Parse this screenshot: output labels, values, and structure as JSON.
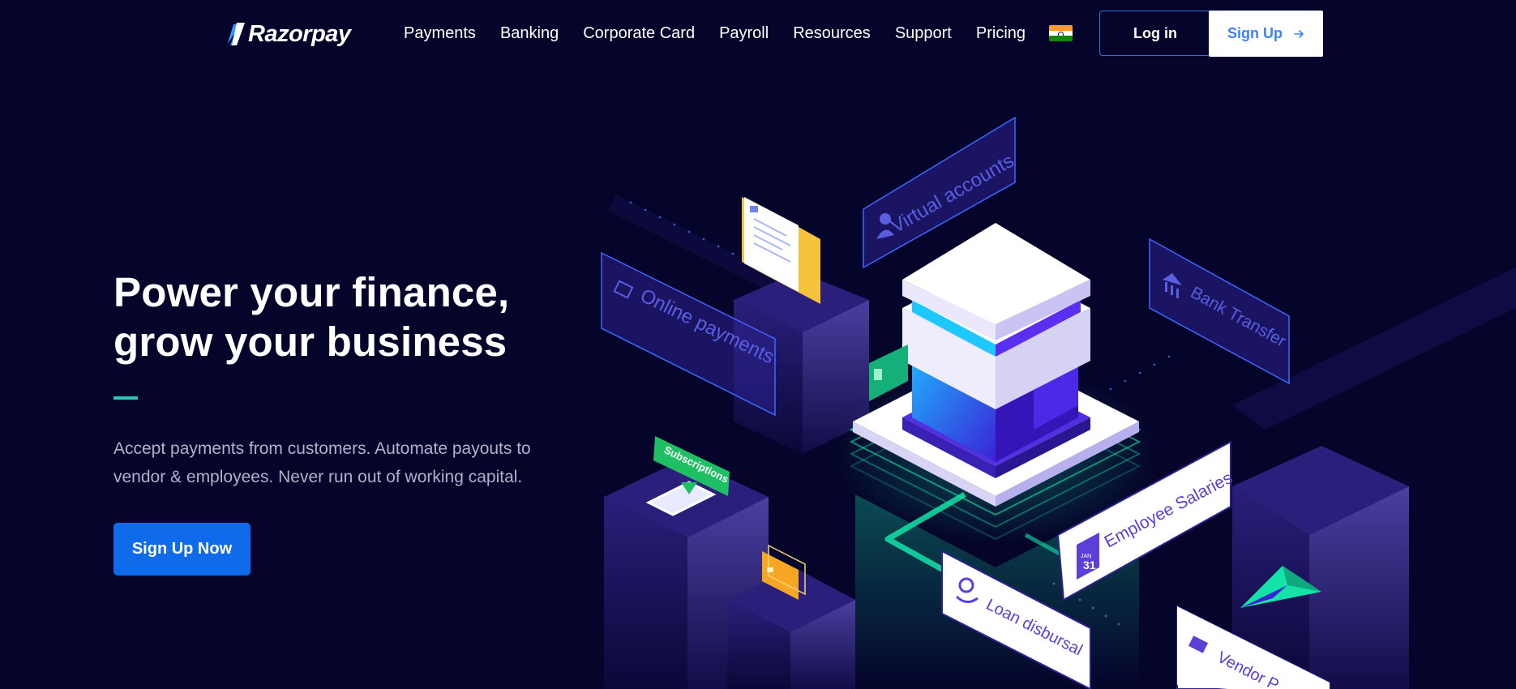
{
  "brand": {
    "name": "Razorpay"
  },
  "nav": {
    "links": [
      "Payments",
      "Banking",
      "Corporate Card",
      "Payroll",
      "Resources",
      "Support",
      "Pricing"
    ],
    "login_label": "Log in",
    "signup_label": "Sign Up",
    "signup_icon": "arrow-right-icon",
    "flag_icon": "india-flag-icon"
  },
  "hero": {
    "title_line1": "Power your finance,",
    "title_line2": "grow your business",
    "subtitle_line1": "Accept payments from customers. Automate payouts to",
    "subtitle_line2": "vendor & employees. Never run out of working capital.",
    "cta_label": "Sign Up Now"
  },
  "illustration": {
    "labels": {
      "virtual_accounts": "Virtual accounts",
      "online_payments": "Online payments",
      "bank_transfer": "Bank Transfer",
      "subscriptions": "Subscriptions",
      "employee_salaries": "Employee Salaries",
      "loan_disbursal": "Loan disbursal",
      "vendor_payments": "Vendor P",
      "calendar_month": "JAN",
      "calendar_day": "31"
    }
  },
  "colors": {
    "background": "#05042a",
    "accent_teal": "#2ec4b6",
    "primary_blue": "#0f6be9",
    "login_border": "#2f6fe0",
    "signup_text": "#3b82f6",
    "glow_green": "#14e3a8",
    "card_purple": "#5b3fd6"
  }
}
